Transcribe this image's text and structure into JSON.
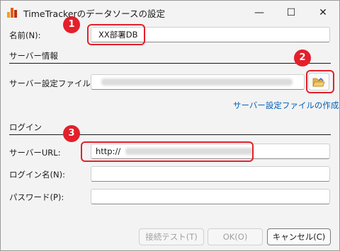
{
  "window": {
    "title": "TimeTrackerのデータソースの設定"
  },
  "controls": {
    "minimize": "—",
    "maximize": "☐",
    "close": "✕"
  },
  "name_field": {
    "label": "名前(N):",
    "value": "XX部署DB"
  },
  "server_section": {
    "heading": "サーバー情報",
    "file_label": "サーバー設定ファイル(F):",
    "create_link": "サーバー設定ファイルの作成..."
  },
  "login_section": {
    "heading": "ログイン",
    "url_label": "サーバーURL:",
    "url_value": "http://",
    "login_name_label": "ログイン名(N):",
    "password_label": "パスワード(P):"
  },
  "buttons": {
    "test": "接続テスト(T)",
    "ok": "OK(O)",
    "cancel": "キャンセル(C)"
  },
  "callouts": {
    "one": "1",
    "two": "2",
    "three": "3"
  },
  "colors": {
    "callout": "#e3202b",
    "link": "#005fb8"
  }
}
